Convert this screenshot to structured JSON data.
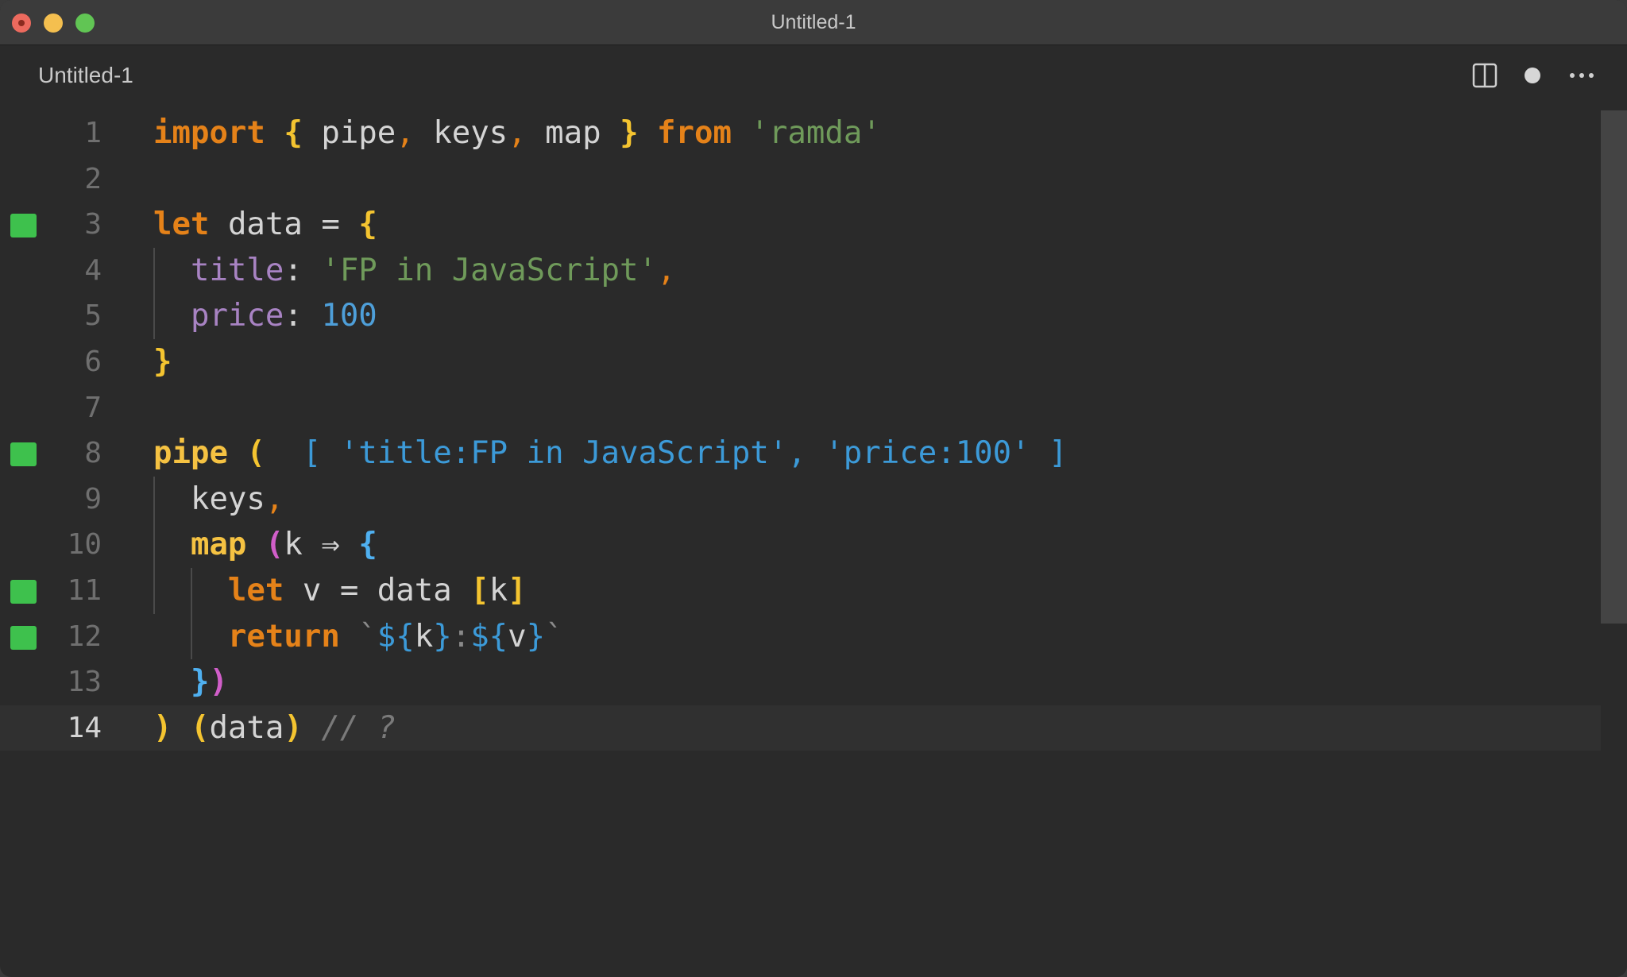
{
  "window": {
    "title": "Untitled-1"
  },
  "tab": {
    "label": "Untitled-1",
    "actions": [
      "split-editor-icon",
      "unsaved-dot-icon",
      "more-actions-icon"
    ]
  },
  "colors": {
    "keyword": "#e58219",
    "string": "#6f9a5a",
    "property": "#a883c3",
    "number": "#4e9fd9",
    "result": "#3c9ad8",
    "coverage_marker": "#3ec14d"
  },
  "editor": {
    "current_line": 14,
    "covered_lines": [
      3,
      8,
      11,
      12
    ],
    "lines": [
      {
        "n": "1"
      },
      {
        "n": "2"
      },
      {
        "n": "3"
      },
      {
        "n": "4"
      },
      {
        "n": "5"
      },
      {
        "n": "6"
      },
      {
        "n": "7"
      },
      {
        "n": "8"
      },
      {
        "n": "9"
      },
      {
        "n": "10"
      },
      {
        "n": "11"
      },
      {
        "n": "12"
      },
      {
        "n": "13"
      },
      {
        "n": "14"
      }
    ],
    "tokens": {
      "l1": [
        "import",
        "{",
        "pipe",
        ",",
        "keys",
        ",",
        "map",
        "}",
        "from",
        "'ramda'"
      ],
      "l3": [
        "let",
        "data",
        "=",
        "{"
      ],
      "l4": [
        "title",
        ":",
        "'FP in JavaScript'",
        ","
      ],
      "l5": [
        "price",
        ":",
        "100"
      ],
      "l6": [
        "}"
      ],
      "l8": [
        "pipe",
        "(",
        "[ ",
        "'title:FP in JavaScript'",
        ", ",
        "'price:100'",
        " ]"
      ],
      "l9": [
        "keys",
        ","
      ],
      "l10": [
        "map",
        "(",
        "k",
        "⇒",
        "{"
      ],
      "l11": [
        "let",
        "v",
        "=",
        "data",
        "[",
        "k",
        "]"
      ],
      "l12": [
        "return",
        "`",
        "${",
        "k",
        "}",
        ":",
        "${",
        "v",
        "}",
        "`"
      ],
      "l13": [
        "}",
        ")"
      ],
      "l14": [
        ")",
        "(",
        "data",
        ")",
        "// ?"
      ]
    }
  }
}
